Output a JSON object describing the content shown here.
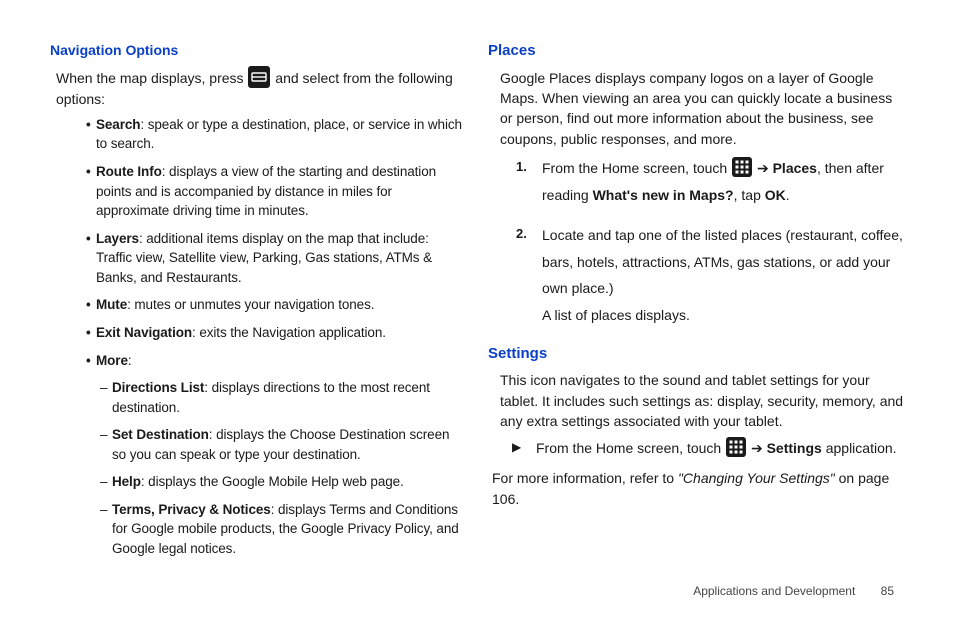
{
  "leftColumn": {
    "heading": "Navigation Options",
    "intro_a": "When the map displays, press ",
    "intro_b": " and select from the following options:",
    "bullets": [
      {
        "label": "Search",
        "text": ": speak or type a destination, place, or service in which to search."
      },
      {
        "label": "Route Info",
        "text": ": displays a view of the starting and destination points and is accompanied by distance in miles for approximate driving time in minutes."
      },
      {
        "label": "Layers",
        "text": ": additional items display on the map that include: Traffic view, Satellite view, Parking, Gas stations, ATMs & Banks, and Restaurants."
      },
      {
        "label": "Mute",
        "text": ": mutes or unmutes your navigation tones."
      },
      {
        "label": "Exit Navigation",
        "text": ": exits the Navigation application."
      },
      {
        "label": "More",
        "text": ":"
      }
    ],
    "moreSub": [
      {
        "label": "Directions List",
        "text": ": displays directions to the most recent destination."
      },
      {
        "label": "Set Destination",
        "text": ": displays the Choose Destination screen so you can speak or type your destination."
      },
      {
        "label": "Help",
        "text": ": displays the Google Mobile Help web page."
      },
      {
        "label": "Terms, Privacy & Notices",
        "text": ": displays Terms and Conditions for Google mobile products, the Google Privacy Policy, and Google legal notices."
      }
    ]
  },
  "rightColumn": {
    "placesHeading": "Places",
    "placesIntro": "Google Places displays company logos on a layer of Google Maps. When viewing an area you can quickly locate a business or person, find out more information about the business, see coupons, public responses, and more.",
    "placesSteps": {
      "s1_a": "From the Home screen, touch ",
      "s1_b": " ➔ ",
      "s1_places": "Places",
      "s1_c": ", then after reading ",
      "s1_whats": "What's new in Maps?",
      "s1_d": ", tap ",
      "s1_ok": "OK",
      "s1_e": ".",
      "s2": "Locate and tap one of the listed places (restaurant, coffee, bars, hotels, attractions, ATMs, gas stations, or add your own place.)",
      "s2_tail": "A list of places displays."
    },
    "settingsHeading": "Settings",
    "settingsIntro": "This icon navigates to the sound and tablet settings for your tablet. It includes such settings as: display, security, memory, and any extra settings associated with your tablet.",
    "settingsStep_a": "From the Home screen, touch ",
    "settingsStep_b": " ➔ ",
    "settingsStep_label": "Settings",
    "settingsStep_c": " application.",
    "settingsRef_a": "For more information, refer to ",
    "settingsRef_title": "\"Changing Your Settings\"",
    "settingsRef_b": "  on page 106."
  },
  "footer": {
    "chapter": "Applications and Development",
    "page": "85"
  },
  "icons": {
    "menu_icon": "menu-icon",
    "grid_icon_1": "apps-grid-icon",
    "grid_icon_2": "apps-grid-icon",
    "arrow_bullet": "▶"
  }
}
